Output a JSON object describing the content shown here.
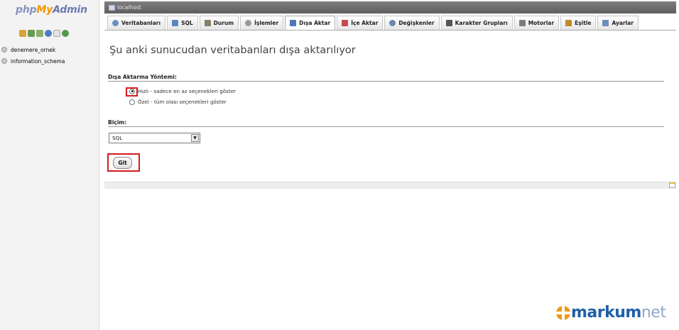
{
  "nav": {
    "logo": {
      "part1": "php",
      "part2": "My",
      "part3": "Admin"
    },
    "icons": [
      "home-icon",
      "database-icon",
      "sql-query-icon",
      "help-icon",
      "docs-icon",
      "reload-icon"
    ],
    "databases": [
      {
        "name": "denemere_ornek"
      },
      {
        "name": "information_schema"
      }
    ]
  },
  "serverbar": {
    "label": "localhost",
    "icon": "server-icon"
  },
  "tabs": [
    {
      "label": "Veritabanları",
      "icon": "database-icon",
      "color": "#6b8fc7"
    },
    {
      "label": "SQL",
      "icon": "sql-icon",
      "color": "#5a86c0"
    },
    {
      "label": "Durum",
      "icon": "status-icon",
      "color": "#8a7f6a"
    },
    {
      "label": "İşlemler",
      "icon": "process-icon",
      "color": "#9a9a9a"
    },
    {
      "label": "Dışa Aktar",
      "icon": "export-icon",
      "color": "#4f79b5",
      "active": true
    },
    {
      "label": "İçe Aktar",
      "icon": "import-icon",
      "color": "#c44b4b"
    },
    {
      "label": "Değişkenler",
      "icon": "variables-icon",
      "color": "#6a86b0"
    },
    {
      "label": "Karakter Grupları",
      "icon": "charset-icon",
      "color": "#555555"
    },
    {
      "label": "Motorlar",
      "icon": "engines-icon",
      "color": "#7d7d7d"
    },
    {
      "label": "Eşitle",
      "icon": "sync-icon",
      "color": "#c28a2a"
    },
    {
      "label": "Ayarlar",
      "icon": "settings-icon",
      "color": "#6e8fb8"
    }
  ],
  "main": {
    "title": "Şu anki sunucudan veritabanları dışa aktarılıyor",
    "method_legend": "Dışa Aktarma Yöntemi:",
    "quick_option": "Hızlı - sadece en az seçenekleri göster",
    "custom_option": "Özel - tüm olası seçenekleri göster",
    "format_legend": "Biçim:",
    "format_value": "SQL",
    "go_label": "Git"
  },
  "brand": {
    "part1": "markum",
    "part2": "net"
  },
  "colors": {
    "highlight": "#d41c1c",
    "brand_orange": "#f09a16",
    "brand_blue": "#1f5fa8"
  }
}
